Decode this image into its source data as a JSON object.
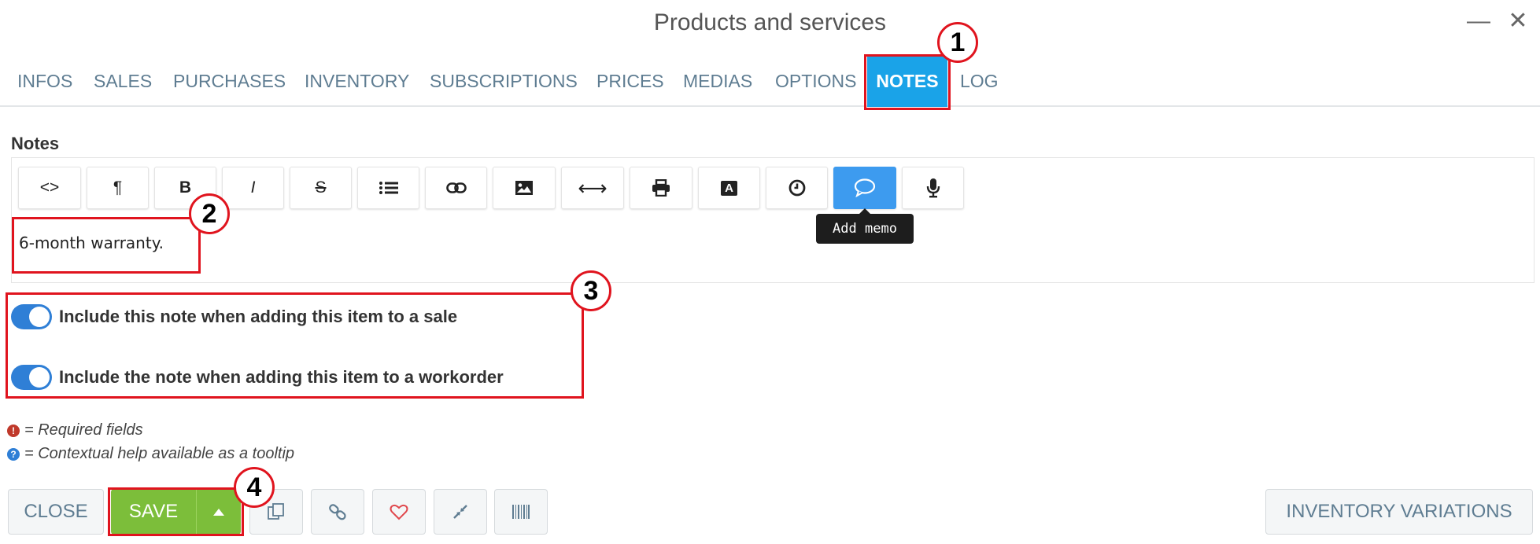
{
  "window": {
    "title": "Products and services",
    "minimize_glyph": "—",
    "close_glyph": "✕"
  },
  "tabs": [
    {
      "label": "INFOS"
    },
    {
      "label": "SALES"
    },
    {
      "label": "PURCHASES"
    },
    {
      "label": "INVENTORY"
    },
    {
      "label": "SUBSCRIPTIONS"
    },
    {
      "label": "PRICES"
    },
    {
      "label": "MEDIAS"
    },
    {
      "label": "OPTIONS"
    },
    {
      "label": "NOTES",
      "active": true
    },
    {
      "label": "LOG"
    }
  ],
  "notes": {
    "label": "Notes",
    "content": "6-month warranty.",
    "toolbar": [
      {
        "icon": "code-view-icon",
        "glyph": "<>"
      },
      {
        "icon": "paragraph-icon",
        "glyph": "¶"
      },
      {
        "icon": "bold-icon",
        "glyph": "B"
      },
      {
        "icon": "italic-icon",
        "glyph": "I"
      },
      {
        "icon": "strikethrough-icon",
        "glyph": "S"
      },
      {
        "icon": "list-icon",
        "glyph": ""
      },
      {
        "icon": "link-icon",
        "glyph": ""
      },
      {
        "icon": "image-icon",
        "glyph": ""
      },
      {
        "icon": "horizontal-rule-icon",
        "glyph": "⟷"
      },
      {
        "icon": "print-icon",
        "glyph": ""
      },
      {
        "icon": "font-icon",
        "glyph": "A"
      },
      {
        "icon": "clock-icon",
        "glyph": ""
      },
      {
        "icon": "memo-icon",
        "glyph": "",
        "active": true
      },
      {
        "icon": "microphone-icon",
        "glyph": ""
      }
    ],
    "tooltip": "Add memo"
  },
  "toggles": [
    {
      "label": "Include this note when adding this item to a sale",
      "on": true
    },
    {
      "label": "Include the note when adding this item to a workorder",
      "on": true
    }
  ],
  "legend": {
    "required_glyph": "!",
    "required": "= Required fields",
    "help_glyph": "?",
    "help": "= Contextual help available as a tooltip"
  },
  "footer": {
    "close": "CLOSE",
    "save": "SAVE",
    "inventory_variations": "INVENTORY VARIATIONS",
    "icon_buttons": [
      "duplicate-icon",
      "link-icon",
      "heart-icon",
      "compress-icon",
      "barcode-icon"
    ]
  },
  "annotations": {
    "one": "1",
    "two": "2",
    "three": "3",
    "four": "4",
    "color": "#e0141e"
  },
  "colors": {
    "active_tab": "#1aa3e8",
    "save_green": "#7cbe3a",
    "toggle_blue": "#2f7fd6",
    "tab_text": "#5f7d92"
  }
}
